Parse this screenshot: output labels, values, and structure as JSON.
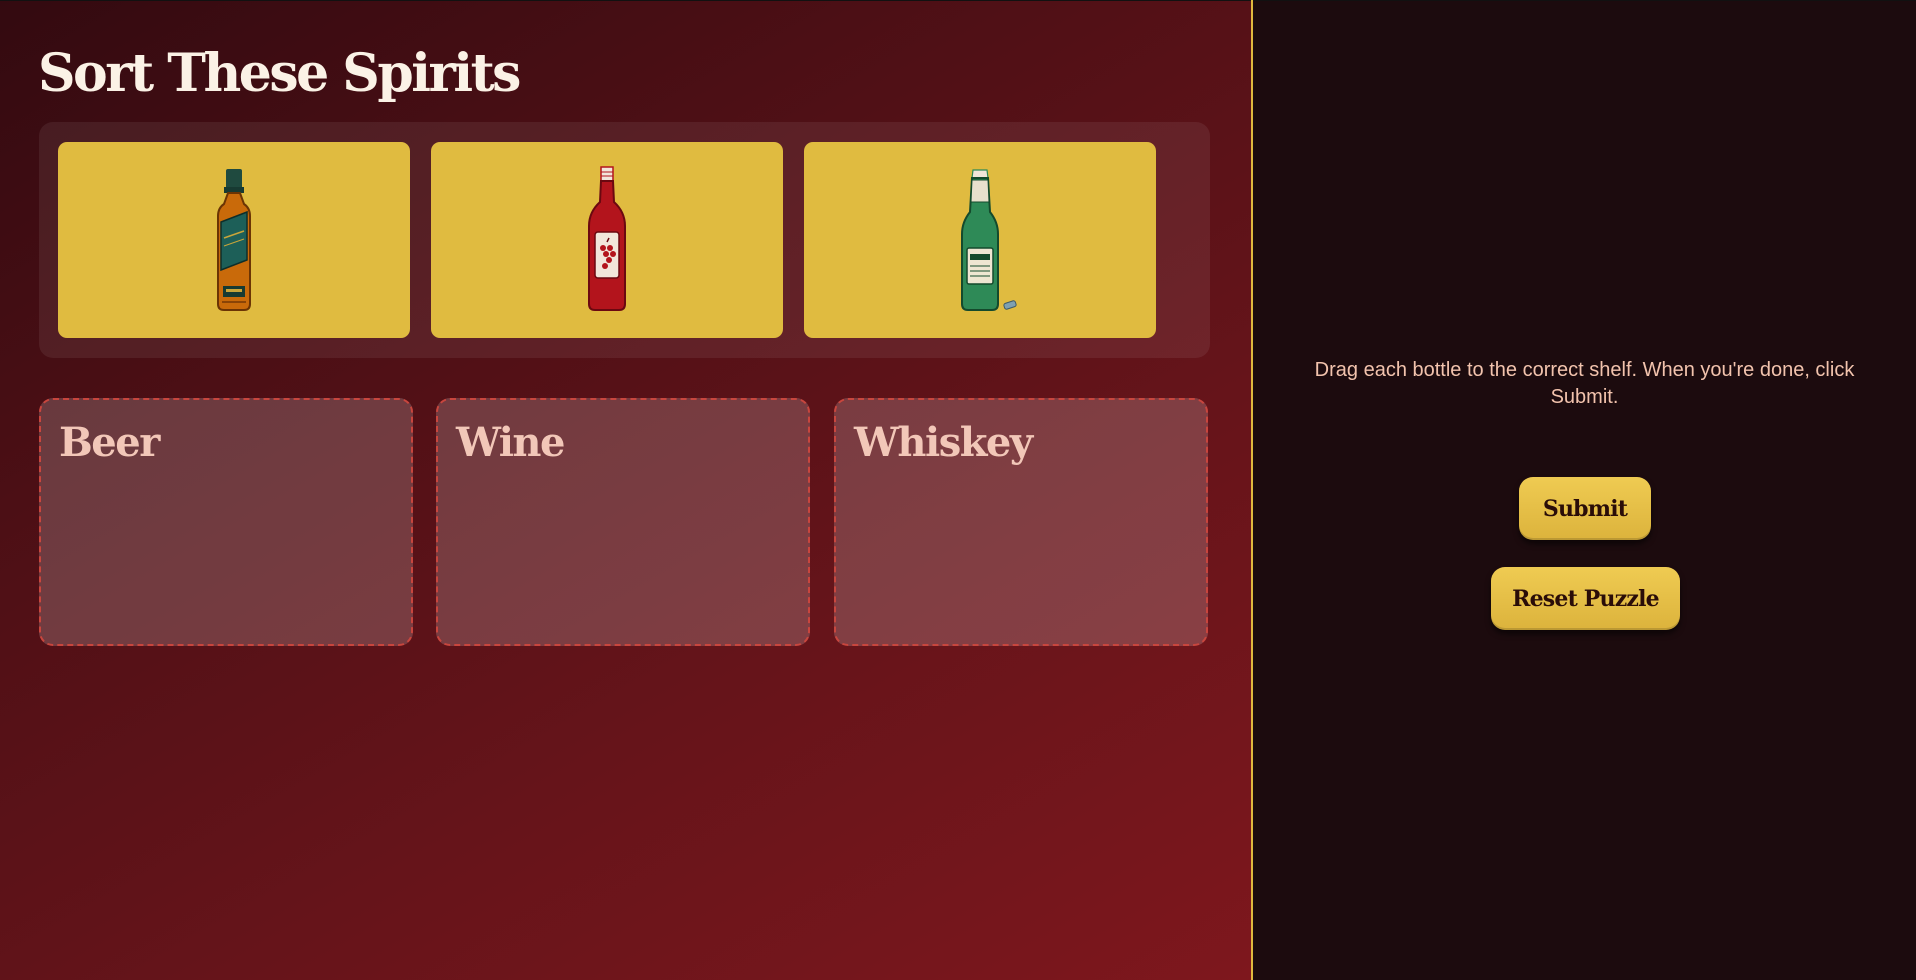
{
  "game": {
    "title": "Sort These Spirits",
    "bottles": [
      {
        "icon": "whiskey-bottle-icon",
        "color": "#c96a0a"
      },
      {
        "icon": "wine-bottle-icon",
        "color": "#b3141c"
      },
      {
        "icon": "beer-bottle-icon",
        "color": "#2e8a57"
      }
    ],
    "shelves": [
      {
        "label": "Beer"
      },
      {
        "label": "Wine"
      },
      {
        "label": "Whiskey"
      }
    ]
  },
  "sidebar": {
    "instructions": "Drag each bottle to the correct shelf. When you're done, click Submit.",
    "submit_label": "Submit",
    "reset_label": "Reset Puzzle"
  },
  "colors": {
    "accent": "#e0bb40",
    "shelf_border": "#c8463e",
    "sidebar_bg": "#1c0b0e"
  }
}
